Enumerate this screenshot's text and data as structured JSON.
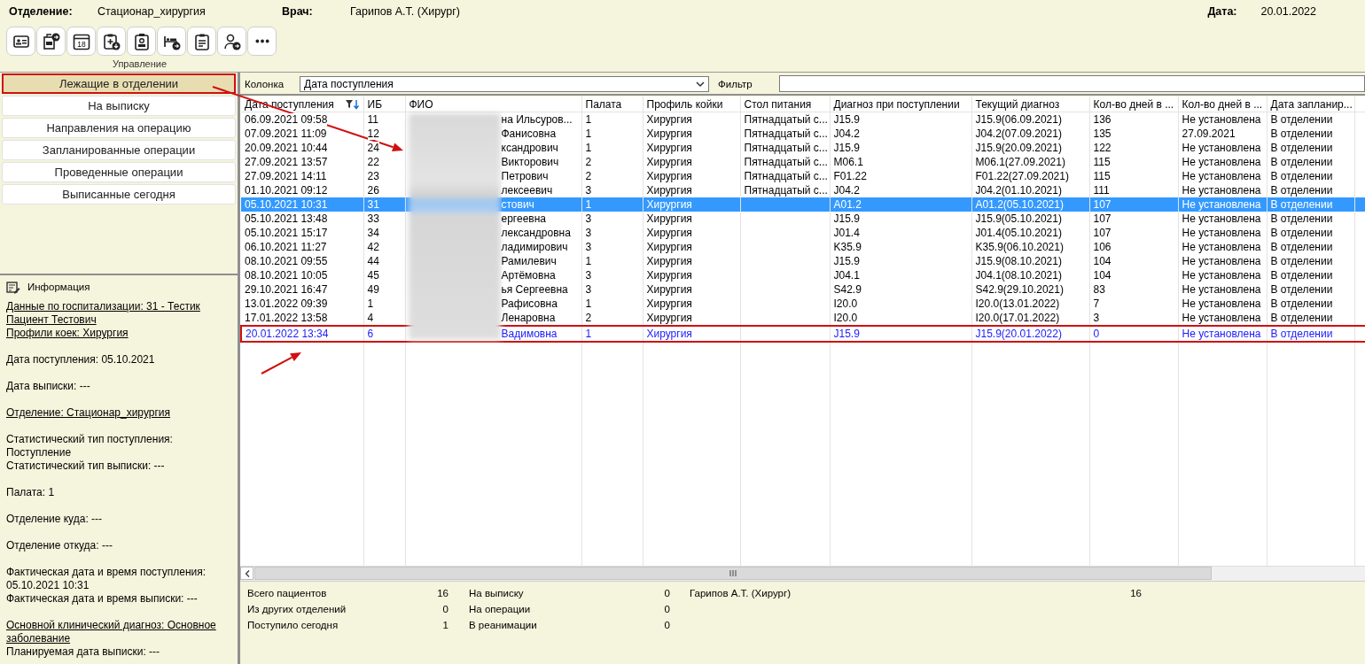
{
  "header": {
    "department_label": "Отделение:",
    "department": "Стационар_хирургия",
    "doctor_label": "Врач:",
    "doctor": "Гарипов А.Т. (Хирург)",
    "date_label": "Дата:",
    "date": "20.01.2022"
  },
  "toolbar": {
    "buttons": [
      {
        "kind": "card"
      },
      {
        "kind": "doc-arrow"
      },
      {
        "kind": "calendar",
        "text": "18"
      },
      {
        "kind": "clipboard-down"
      },
      {
        "kind": "badge"
      },
      {
        "kind": "bed-arrow"
      },
      {
        "kind": "clipboard"
      },
      {
        "kind": "person-arrow"
      },
      {
        "kind": "more"
      }
    ],
    "label": "Управление"
  },
  "nav": [
    {
      "label": "Лежащие в отделении",
      "selected": true,
      "outlined": true
    },
    {
      "label": "На выписку",
      "selected": false,
      "outlined": false
    },
    {
      "label": "Направления на операцию",
      "selected": false,
      "outlined": false
    },
    {
      "label": "Запланированные операции",
      "selected": false,
      "outlined": false
    },
    {
      "label": "Проведенные операции",
      "selected": false,
      "outlined": false
    },
    {
      "label": "Выписанные сегодня",
      "selected": false,
      "outlined": false
    }
  ],
  "info": {
    "title": "Информация",
    "sections": [
      [
        {
          "text": "Данные по госпитализации: 31 - Тестик Пациент Тестович",
          "kind": "link"
        },
        {
          "text": "Профили коек: Хирургия",
          "kind": "link"
        }
      ],
      [
        {
          "text": "Дата поступления: 05.10.2021",
          "kind": "text"
        }
      ],
      [
        {
          "text": "Дата выписки: ---",
          "kind": "text"
        }
      ],
      [
        {
          "text": "Отделение: Стационар_хирургия",
          "kind": "link"
        }
      ],
      [
        {
          "text": "Статистический тип поступления: Поступление",
          "kind": "text"
        },
        {
          "text": "Статистический тип выписки: ---",
          "kind": "text"
        }
      ],
      [
        {
          "text": "Палата: 1",
          "kind": "text"
        }
      ],
      [
        {
          "text": "Отделение куда: ---",
          "kind": "text"
        }
      ],
      [
        {
          "text": "Отделение откуда: ---",
          "kind": "text"
        }
      ],
      [
        {
          "text": "Фактическая дата и время поступления: 05.10.2021 10:31",
          "kind": "text"
        },
        {
          "text": "Фактическая дата и время выписки: ---",
          "kind": "text"
        }
      ],
      [
        {
          "text": "Основной клинический диагноз: Основное заболевание",
          "kind": "link"
        },
        {
          "text": "Планируемая дата выписки: ---",
          "kind": "text"
        }
      ]
    ]
  },
  "filter": {
    "column_label": "Колонка",
    "column_value": "Дата поступления",
    "filter_label": "Фильтр"
  },
  "table": {
    "name_column_blurred": true,
    "columns": [
      {
        "label": "Дата поступления",
        "sorted": true
      },
      {
        "label": "ИБ",
        "sorted": false
      },
      {
        "label": "ФИО",
        "sorted": false
      },
      {
        "label": "Палата",
        "sorted": false
      },
      {
        "label": "Профиль койки",
        "sorted": false
      },
      {
        "label": "Стол питания",
        "sorted": false
      },
      {
        "label": "Диагноз при поступлении",
        "sorted": false
      },
      {
        "label": "Текущий диагноз",
        "sorted": false
      },
      {
        "label": "Кол-во дней в ...",
        "sorted": false
      },
      {
        "label": "Кол-во дней в ...",
        "sorted": false
      },
      {
        "label": "Дата запланир...",
        "sorted": false
      }
    ],
    "rows": [
      {
        "date": "06.09.2021 09:58",
        "ib": "11",
        "name": "на Ильсуров...",
        "ward": "1",
        "bed_profile": "Хирургия",
        "diet": "Пятнадцатый с...",
        "admission_dx": "J15.9",
        "current_dx": "J15.9(06.09.2021)",
        "days_1": "136",
        "days_2": "Не установлена",
        "planned_date": "В отделении",
        "selected": false,
        "new": false,
        "outlined": false
      },
      {
        "date": "07.09.2021 11:09",
        "ib": "12",
        "name": "Фанисовна",
        "ward": "1",
        "bed_profile": "Хирургия",
        "diet": "Пятнадцатый с...",
        "admission_dx": "J04.2",
        "current_dx": "J04.2(07.09.2021)",
        "days_1": "135",
        "days_2": "27.09.2021",
        "planned_date": "В отделении",
        "selected": false,
        "new": false,
        "outlined": false
      },
      {
        "date": "20.09.2021 10:44",
        "ib": "24",
        "name": "ксандрович",
        "ward": "1",
        "bed_profile": "Хирургия",
        "diet": "Пятнадцатый с...",
        "admission_dx": "J15.9",
        "current_dx": "J15.9(20.09.2021)",
        "days_1": "122",
        "days_2": "Не установлена",
        "planned_date": "В отделении",
        "selected": false,
        "new": false,
        "outlined": false
      },
      {
        "date": "27.09.2021 13:57",
        "ib": "22",
        "name": "Викторович",
        "ward": "2",
        "bed_profile": "Хирургия",
        "diet": "Пятнадцатый с...",
        "admission_dx": "M06.1",
        "current_dx": "M06.1(27.09.2021)",
        "days_1": "115",
        "days_2": "Не установлена",
        "planned_date": "В отделении",
        "selected": false,
        "new": false,
        "outlined": false
      },
      {
        "date": "27.09.2021 14:11",
        "ib": "23",
        "name": "Петрович",
        "ward": "2",
        "bed_profile": "Хирургия",
        "diet": "Пятнадцатый с...",
        "admission_dx": "F01.22",
        "current_dx": "F01.22(27.09.2021)",
        "days_1": "115",
        "days_2": "Не установлена",
        "planned_date": "В отделении",
        "selected": false,
        "new": false,
        "outlined": false
      },
      {
        "date": "01.10.2021 09:12",
        "ib": "26",
        "name": "лексеевич",
        "ward": "3",
        "bed_profile": "Хирургия",
        "diet": "Пятнадцатый с...",
        "admission_dx": "J04.2",
        "current_dx": "J04.2(01.10.2021)",
        "days_1": "111",
        "days_2": "Не установлена",
        "planned_date": "В отделении",
        "selected": false,
        "new": false,
        "outlined": false
      },
      {
        "date": "05.10.2021 10:31",
        "ib": "31",
        "name": "стович",
        "ward": "1",
        "bed_profile": "Хирургия",
        "admission_dx": "A01.2",
        "current_dx": "A01.2(05.10.2021)",
        "days_1": "107",
        "days_2": "Не установлена",
        "planned_date": "В отделении",
        "selected": true,
        "new": false,
        "outlined": false
      },
      {
        "date": "05.10.2021 13:48",
        "ib": "33",
        "name": "ергеевна",
        "ward": "3",
        "bed_profile": "Хирургия",
        "admission_dx": "J15.9",
        "current_dx": "J15.9(05.10.2021)",
        "days_1": "107",
        "days_2": "Не установлена",
        "planned_date": "В отделении",
        "selected": false,
        "new": false,
        "outlined": false
      },
      {
        "date": "05.10.2021 15:17",
        "ib": "34",
        "name": "лександровна",
        "ward": "3",
        "bed_profile": "Хирургия",
        "admission_dx": "J01.4",
        "current_dx": "J01.4(05.10.2021)",
        "days_1": "107",
        "days_2": "Не установлена",
        "planned_date": "В отделении",
        "selected": false,
        "new": false,
        "outlined": false
      },
      {
        "date": "06.10.2021 11:27",
        "ib": "42",
        "name": "ладимирович",
        "ward": "3",
        "bed_profile": "Хирургия",
        "admission_dx": "K35.9",
        "current_dx": "K35.9(06.10.2021)",
        "days_1": "106",
        "days_2": "Не установлена",
        "planned_date": "В отделении",
        "selected": false,
        "new": false,
        "outlined": false
      },
      {
        "date": "08.10.2021 09:55",
        "ib": "44",
        "name": "Рамилевич",
        "ward": "1",
        "bed_profile": "Хирургия",
        "admission_dx": "J15.9",
        "current_dx": "J15.9(08.10.2021)",
        "days_1": "104",
        "days_2": "Не установлена",
        "planned_date": "В отделении",
        "selected": false,
        "new": false,
        "outlined": false
      },
      {
        "date": "08.10.2021 10:05",
        "ib": "45",
        "name": "Артёмовна",
        "ward": "3",
        "bed_profile": "Хирургия",
        "admission_dx": "J04.1",
        "current_dx": "J04.1(08.10.2021)",
        "days_1": "104",
        "days_2": "Не установлена",
        "planned_date": "В отделении",
        "selected": false,
        "new": false,
        "outlined": false
      },
      {
        "date": "29.10.2021 16:47",
        "ib": "49",
        "name": "ья Сергеевна",
        "ward": "3",
        "bed_profile": "Хирургия",
        "admission_dx": "S42.9",
        "current_dx": "S42.9(29.10.2021)",
        "days_1": "83",
        "days_2": "Не установлена",
        "planned_date": "В отделении",
        "selected": false,
        "new": false,
        "outlined": false
      },
      {
        "date": "13.01.2022 09:39",
        "ib": "1",
        "name": "Рафисовна",
        "ward": "1",
        "bed_profile": "Хирургия",
        "admission_dx": "I20.0",
        "current_dx": "I20.0(13.01.2022)",
        "days_1": "7",
        "days_2": "Не установлена",
        "planned_date": "В отделении",
        "selected": false,
        "new": false,
        "outlined": false
      },
      {
        "date": "17.01.2022 13:58",
        "ib": "4",
        "name": "Ленаровна",
        "ward": "2",
        "bed_profile": "Хирургия",
        "admission_dx": "I20.0",
        "current_dx": "I20.0(17.01.2022)",
        "days_1": "3",
        "days_2": "Не установлена",
        "planned_date": "В отделении",
        "selected": false,
        "new": false,
        "outlined": false
      },
      {
        "date": "20.01.2022 13:34",
        "ib": "6",
        "name": "Вадимовна",
        "ward": "1",
        "bed_profile": "Хирургия",
        "admission_dx": "J15.9",
        "current_dx": "J15.9(20.01.2022)",
        "days_1": "0",
        "days_2": "Не установлена",
        "planned_date": "В отделении",
        "selected": false,
        "new": true,
        "outlined": true
      }
    ]
  },
  "summary": [
    [
      {
        "label": "Всего пациентов",
        "value": "16"
      },
      {
        "label": "Из других отделений",
        "value": "0"
      },
      {
        "label": "Поступило сегодня",
        "value": "1"
      }
    ],
    [
      {
        "label": "На выписку",
        "value": "0"
      },
      {
        "label": "На операции",
        "value": "0"
      },
      {
        "label": "В реанимации",
        "value": "0"
      }
    ],
    [
      {
        "label": "Гарипов А.Т. (Хирург)",
        "value": "16"
      }
    ]
  ],
  "annotations": [
    {
      "kind": "arrow"
    },
    {
      "kind": "arrow"
    }
  ]
}
